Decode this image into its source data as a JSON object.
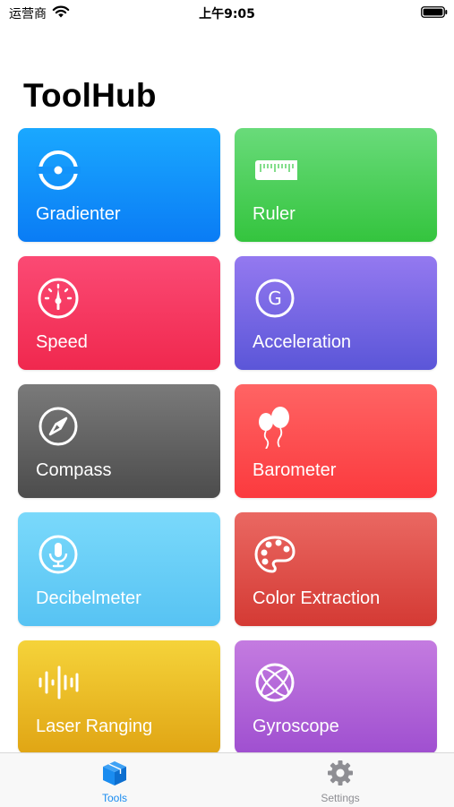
{
  "status_bar": {
    "carrier": "运营商",
    "time": "上午9:05",
    "wifi_icon": "wifi-icon",
    "battery_icon": "battery-icon"
  },
  "title": "ToolHub",
  "tiles": [
    {
      "label": "Gradienter",
      "icon": "gradienter-icon",
      "color": "#0a7cf5"
    },
    {
      "label": "Ruler",
      "icon": "ruler-icon",
      "color": "#34c43e"
    },
    {
      "label": "Speed",
      "icon": "speedometer-icon",
      "color": "#f0284e"
    },
    {
      "label": "Acceleration",
      "icon": "g-circle-icon",
      "color": "#5b56d8"
    },
    {
      "label": "Compass",
      "icon": "compass-icon",
      "color": "#4c4c4c"
    },
    {
      "label": "Barometer",
      "icon": "balloons-icon",
      "color": "#fb3a3e"
    },
    {
      "label": "Decibelmeter",
      "icon": "microphone-icon",
      "color": "#57c3f3"
    },
    {
      "label": "Color Extraction",
      "icon": "palette-icon",
      "color": "#d43a34"
    },
    {
      "label": "Laser Ranging",
      "icon": "waveform-icon",
      "color": "#e0a514"
    },
    {
      "label": "Gyroscope",
      "icon": "gyroscope-icon",
      "color": "#9f4fd0"
    }
  ],
  "tab_bar": {
    "tools": {
      "label": "Tools",
      "icon": "cube-icon",
      "color": "#1a8cf0"
    },
    "settings": {
      "label": "Settings",
      "icon": "gear-icon",
      "color": "#8e8e93"
    }
  }
}
